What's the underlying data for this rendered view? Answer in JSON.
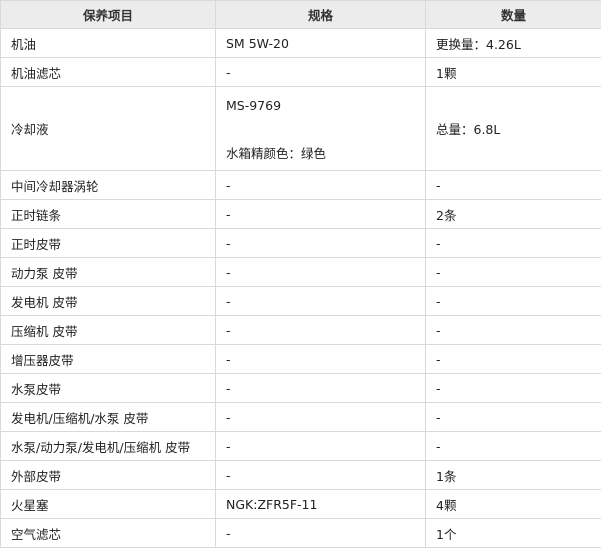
{
  "header": {
    "col1": "保养项目",
    "col2": "规格",
    "col3": "数量"
  },
  "rows": [
    {
      "item": "机油",
      "spec": "SM 5W-20",
      "qty": "更换量：4.26L"
    },
    {
      "item": "机油滤芯",
      "spec": "-",
      "qty": "1颗"
    },
    {
      "item": "冷却液",
      "spec": "MS-9769",
      "spec_note": "水箱精颜色：绿色",
      "qty": "总量：6.8L"
    },
    {
      "item": "中间冷却器涡轮",
      "spec": "-",
      "qty": "-"
    },
    {
      "item": "正时链条",
      "spec": "-",
      "qty": "2条"
    },
    {
      "item": "正时皮带",
      "spec": "-",
      "qty": "-"
    },
    {
      "item": "动力泵 皮带",
      "spec": "-",
      "qty": "-"
    },
    {
      "item": "发电机 皮带",
      "spec": "-",
      "qty": "-"
    },
    {
      "item": "压缩机 皮带",
      "spec": "-",
      "qty": "-"
    },
    {
      "item": "增压器皮带",
      "spec": "-",
      "qty": "-"
    },
    {
      "item": "水泵皮带",
      "spec": "-",
      "qty": "-"
    },
    {
      "item": "发电机/压缩机/水泵 皮带",
      "spec": "-",
      "qty": "-"
    },
    {
      "item": "水泵/动力泵/发电机/压缩机 皮带",
      "spec": "-",
      "qty": "-"
    },
    {
      "item": "外部皮带",
      "spec": "-",
      "qty": "1条"
    },
    {
      "item": "火星塞",
      "spec": "NGK:ZFR5F-11",
      "qty": "4颗"
    },
    {
      "item": "空气滤芯",
      "spec": "-",
      "qty": "1个"
    }
  ]
}
